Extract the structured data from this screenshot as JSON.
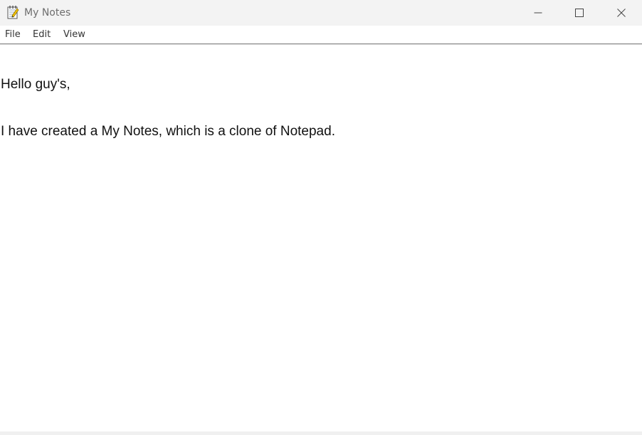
{
  "window": {
    "title": "My Notes",
    "icon": "notepad-icon",
    "controls": {
      "minimize_icon": "minimize-icon",
      "maximize_icon": "maximize-icon",
      "close_icon": "close-icon"
    }
  },
  "menubar": {
    "items": [
      {
        "label": "File"
      },
      {
        "label": "Edit"
      },
      {
        "label": "View"
      }
    ]
  },
  "editor": {
    "lines": [
      "Hello guy's,",
      "I have created a My Notes, which is a clone of Notepad."
    ]
  },
  "colors": {
    "titlebar_bg": "#f3f3f3",
    "title_text": "#6e6e6e",
    "menu_text": "#333333",
    "editor_text": "#111111",
    "editor_bg": "#ffffff"
  }
}
